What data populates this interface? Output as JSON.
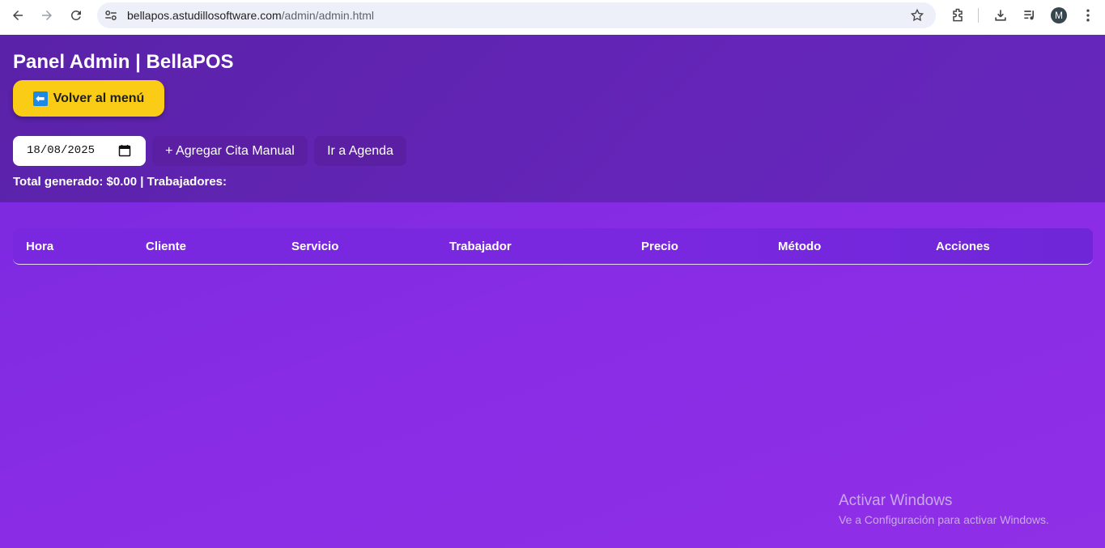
{
  "browser": {
    "url_host": "bellapos.astudillosoftware.com",
    "url_path": "/admin/admin.html",
    "avatar_letter": "M",
    "icons": [
      "back-icon",
      "forward-icon",
      "reload-icon",
      "site-info-icon",
      "bookmark-star-icon",
      "extensions-icon",
      "download-icon",
      "media-icon",
      "menu-icon"
    ]
  },
  "header": {
    "title": "Panel Admin | BellaPOS",
    "back_button": {
      "arrow": "⬅",
      "label": "Volver al menú"
    },
    "date_value": "18/08/2025",
    "add_button": "+ Agregar Cita Manual",
    "agenda_button": "Ir a Agenda",
    "totals": "Total generado: $0.00 | Trabajadores:"
  },
  "table": {
    "columns": [
      "Hora",
      "Cliente",
      "Servicio",
      "Trabajador",
      "Precio",
      "Método",
      "Acciones"
    ],
    "rows": []
  },
  "watermark": {
    "line1": "Activar Windows",
    "line2": "Ve a Configuración para activar Windows."
  },
  "colors": {
    "header_bg": "#5f24b0",
    "page_bg": "#8a2ce6",
    "accent_button": "#facc15",
    "secondary_button": "#5a1fa3"
  }
}
